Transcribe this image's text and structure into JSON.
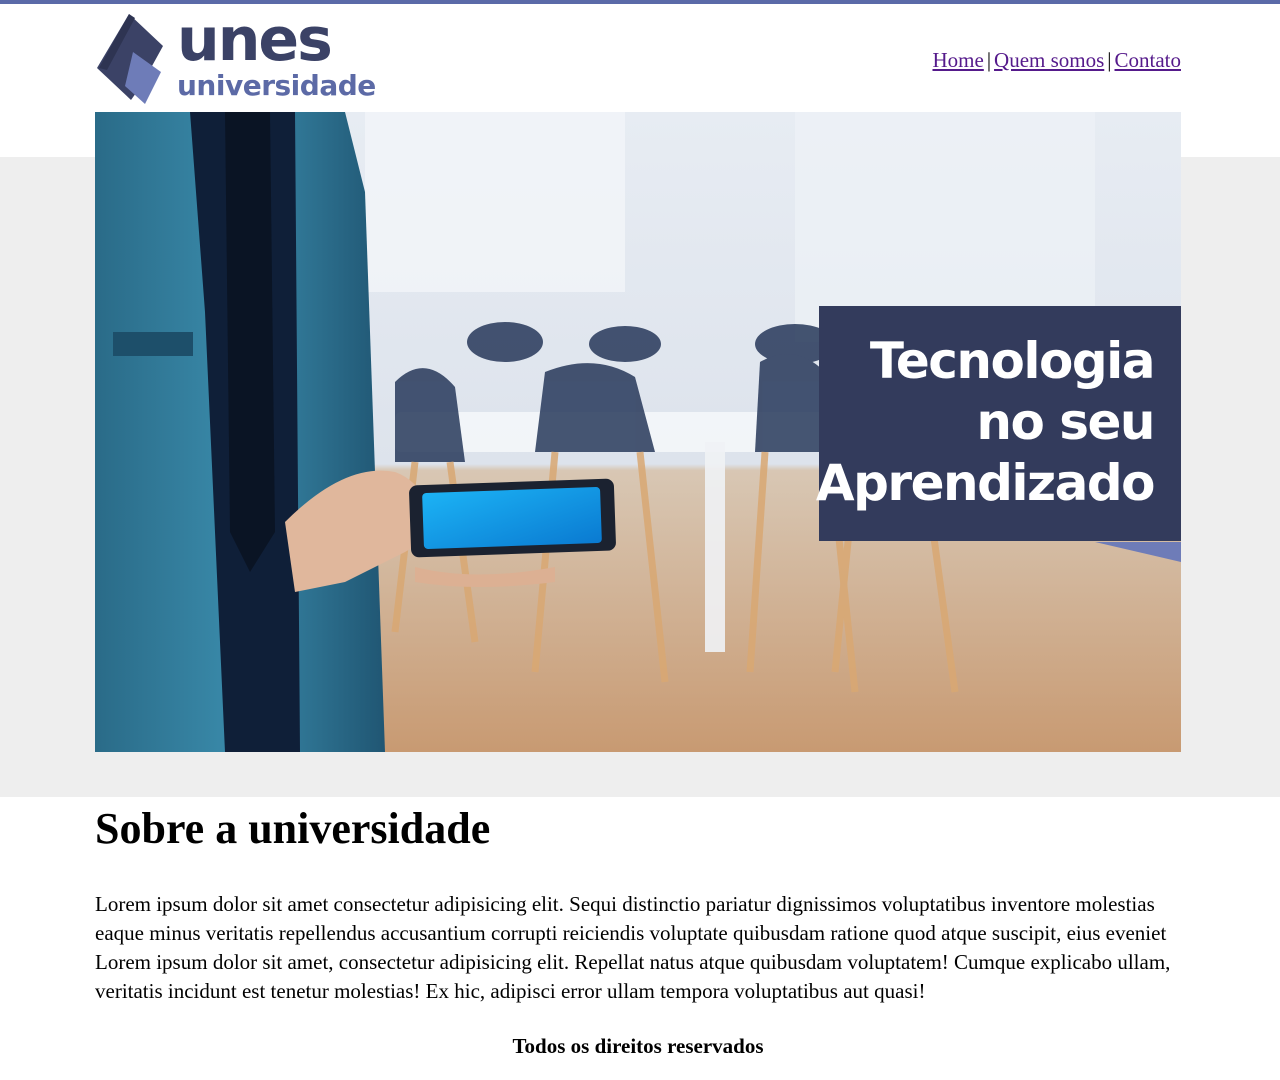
{
  "header": {
    "logo": {
      "word": "unes",
      "sub": "universidade"
    },
    "nav": [
      {
        "label": "Home"
      },
      {
        "label": "Quem somos"
      },
      {
        "label": "Contato"
      }
    ],
    "nav_separator": "|"
  },
  "hero": {
    "banner_lines": [
      "Tecnologia",
      "no seu",
      "Aprendizado"
    ],
    "colors": {
      "banner": "#333b5c",
      "accent": "#5b6aa8"
    }
  },
  "content": {
    "title": "Sobre a universidade",
    "paragraph": "Lorem ipsum dolor sit amet consectetur adipisicing elit. Sequi distinctio pariatur dignissimos voluptatibus inventore molestias eaque minus veritatis repellendus accusantium corrupti reiciendis voluptate quibusdam ratione quod atque suscipit, eius eveniet Lorem ipsum dolor sit amet, consectetur adipisicing elit. Repellat natus atque quibusdam voluptatem! Cumque explicabo ullam, veritatis incidunt est tenetur molestias! Ex hic, adipisci error ullam tempora voluptatibus aut quasi!"
  },
  "footer": {
    "text": "Todos os direitos reservados"
  }
}
